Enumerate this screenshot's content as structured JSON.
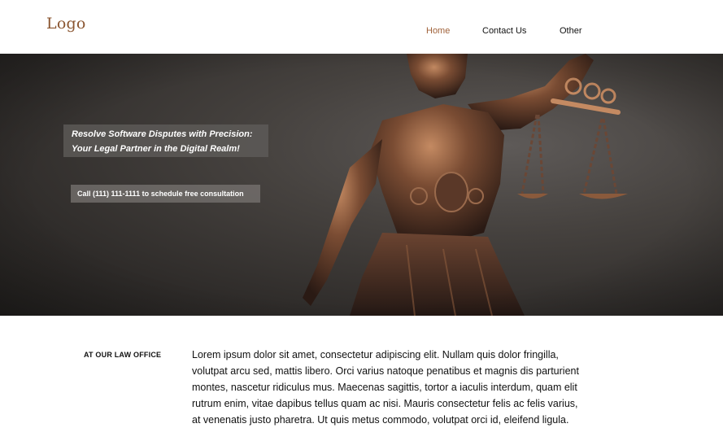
{
  "header": {
    "logo": "Logo",
    "nav": [
      {
        "label": "Home",
        "active": true
      },
      {
        "label": "Contact Us",
        "active": false
      },
      {
        "label": "Other",
        "active": false
      }
    ]
  },
  "hero": {
    "tagline_lines": [
      "Resolve Software Disputes with Precision:",
      "Your Legal Partner in the Digital Realm!"
    ],
    "cta": "Call (111) 111-1111 to schedule free consultation",
    "image": "lady-justice-statue-photo"
  },
  "about": {
    "label": "AT OUR LAW OFFICE",
    "lines": [
      "Lorem ipsum dolor sit amet, consectetur adipiscing elit. Nullam quis dolor fringilla,",
      "volutpat arcu sed, mattis libero. Orci varius natoque penatibus et magnis dis parturient",
      "montes, nascetur ridiculus mus. Maecenas sagittis, tortor a iaculis interdum, quam elit",
      "rutrum enim, vitae dapibus tellus quam ac nisi. Mauris consectetur felis ac felis varius,",
      "at venenatis justo pharetra. Ut quis metus commodo, volutpat orci id, eleifend ligula."
    ]
  },
  "colors": {
    "accent": "#a0623a",
    "logo": "#8a5530",
    "hero_bg": "#3a3735",
    "bronze": "#8a5a3c"
  }
}
